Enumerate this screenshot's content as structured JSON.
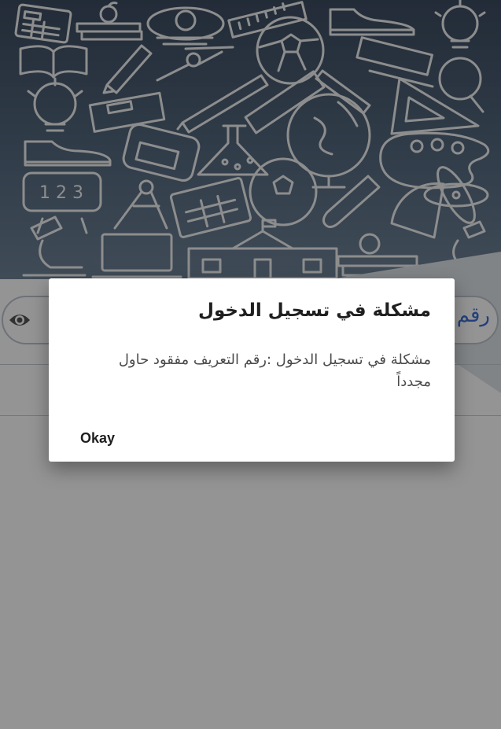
{
  "background": {
    "header_color": "#4a5c72",
    "doodle_icons": [
      "calculator-icon",
      "books-apple-icon",
      "school-bell-icon",
      "ruler-icon",
      "sneaker-icon",
      "lightbulb-icon",
      "open-book-icon",
      "pencil-icon",
      "compass-icon",
      "soccer-ball-icon",
      "book-icon",
      "magnifier-icon",
      "lightbulb-icon",
      "closed-book-icon",
      "pen-icon",
      "triangle-ruler-icon",
      "sneaker-icon",
      "backpack-icon",
      "flask-icon",
      "globe-icon",
      "palette-icon",
      "number-board-icon",
      "calculator-icon",
      "test-tube-icon",
      "atom-icon",
      "protractor-icon",
      "microscope-icon",
      "laptop-icon",
      "school-building-icon",
      "books-apple-icon"
    ]
  },
  "login_form": {
    "password_placeholder": "رقم",
    "eye_icon": "eye-icon"
  },
  "dialog": {
    "title": "مشكلة في تسجيل الدخول",
    "message": "مشكلة في تسجيل الدخول :رقم التعريف  مفقود حاول مجدداً",
    "button_label": "Okay"
  }
}
